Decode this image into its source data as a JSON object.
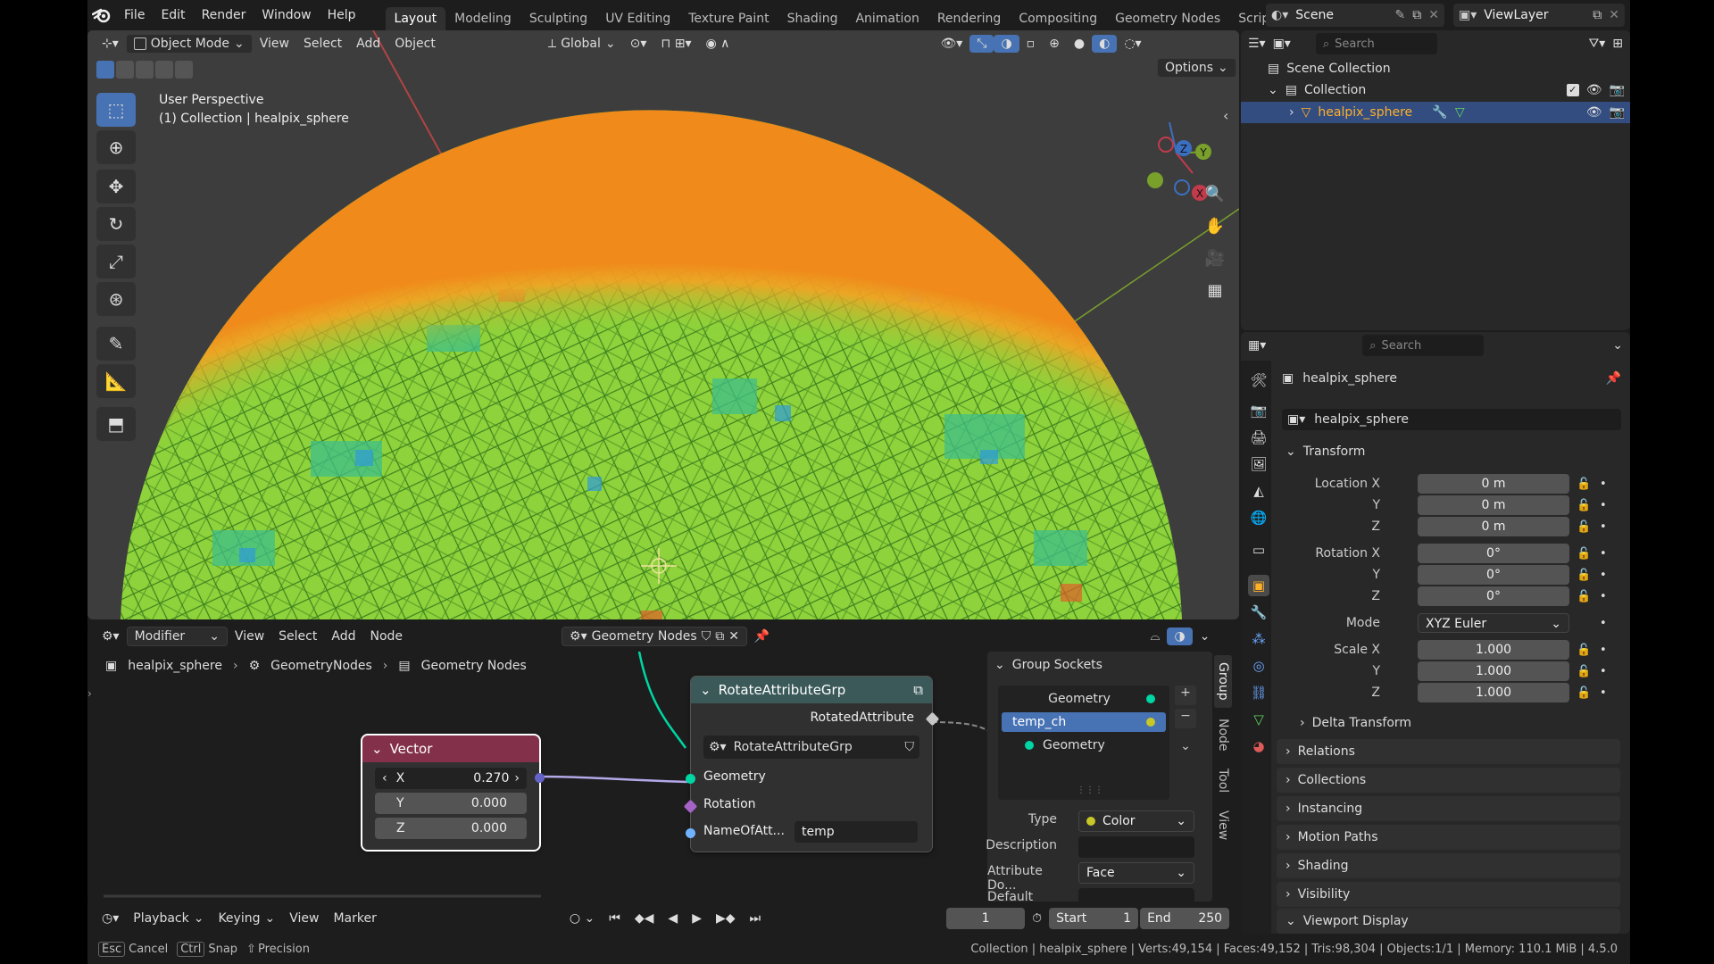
{
  "topbar": {
    "menus": [
      "File",
      "Edit",
      "Render",
      "Window",
      "Help"
    ],
    "workspaces": [
      "Layout",
      "Modeling",
      "Sculpting",
      "UV Editing",
      "Texture Paint",
      "Shading",
      "Animation",
      "Rendering",
      "Compositing",
      "Geometry Nodes",
      "Scripting"
    ],
    "active_workspace": "Layout",
    "add_tab": "+",
    "scene": "Scene",
    "view_layer": "ViewLayer"
  },
  "viewport": {
    "mode": "Object Mode",
    "menus": [
      "View",
      "Select",
      "Add",
      "Object"
    ],
    "orientation": "Global",
    "options": "Options",
    "overlay_title": "User Perspective",
    "overlay_subtitle": "(1) Collection | healpix_sphere",
    "gizmo": {
      "x": "X",
      "y": "Y",
      "z": "Z"
    }
  },
  "node_editor": {
    "editor_type": "Modifier",
    "menus": [
      "View",
      "Select",
      "Add",
      "Node"
    ],
    "tree_name": "Geometry Nodes",
    "breadcrumb": [
      "healpix_sphere",
      "GeometryNodes",
      "Geometry Nodes"
    ],
    "group_node": {
      "title": "RotateAttributeGrp",
      "output": "RotatedAttribute",
      "datablock": "RotateAttributeGrp",
      "inputs": [
        "Geometry",
        "Rotation",
        "NameOfAtt..."
      ],
      "name_value": "temp"
    },
    "vector_node": {
      "title": "Vector",
      "x_label": "X",
      "x": "0.270",
      "y_label": "Y",
      "y": "0.000",
      "z_label": "Z",
      "z": "0.000"
    },
    "group_sockets": {
      "title": "Group Sockets",
      "items": [
        "Geometry",
        "temp_ch",
        "Geometry"
      ],
      "type_label": "Type",
      "type_value": "Color",
      "description_label": "Description",
      "attr_domain_label": "Attribute Do...",
      "attr_domain_value": "Face",
      "default_attr_label": "Default Attri..."
    },
    "side_tabs": [
      "Group",
      "Node",
      "Tool",
      "View"
    ]
  },
  "timeline": {
    "menus": [
      "Playback",
      "Keying",
      "View",
      "Marker"
    ],
    "current_frame": "1",
    "start_label": "Start",
    "start": "1",
    "end_label": "End",
    "end": "250"
  },
  "statusbar": {
    "esc": "Esc",
    "cancel": "Cancel",
    "ctrl": "Ctrl",
    "snap": "Snap",
    "precision": "Precision",
    "info": "Collection | healpix_sphere | Verts:49,154 | Faces:49,152 | Tris:98,304 | Objects:1/1 | Memory: 110.1 MiB | 4.5.0"
  },
  "outliner": {
    "search_placeholder": "Search",
    "scene_collection": "Scene Collection",
    "collection": "Collection",
    "object": "healpix_sphere"
  },
  "properties": {
    "search_placeholder": "Search",
    "object_name": "healpix_sphere",
    "data_name": "healpix_sphere",
    "transform": "Transform",
    "location_x_label": "Location X",
    "location_x": "0 m",
    "location_y_label": "Y",
    "location_y": "0 m",
    "location_z_label": "Z",
    "location_z": "0 m",
    "rotation_x_label": "Rotation X",
    "rotation_x": "0°",
    "rotation_y_label": "Y",
    "rotation_y": "0°",
    "rotation_z_label": "Z",
    "rotation_z": "0°",
    "mode_label": "Mode",
    "mode": "XYZ Euler",
    "scale_x_label": "Scale X",
    "scale_x": "1.000",
    "scale_y_label": "Y",
    "scale_y": "1.000",
    "scale_z_label": "Z",
    "scale_z": "1.000",
    "delta_transform": "Delta Transform",
    "panels": [
      "Relations",
      "Collections",
      "Instancing",
      "Motion Paths",
      "Shading",
      "Visibility",
      "Viewport Display"
    ]
  },
  "colors": {
    "accent": "#4772b3",
    "selected_text": "#ffaf29",
    "vector_header": "#83314a",
    "group_header": "#3b5959",
    "geometry_socket": "#00d6a3",
    "vector_socket": "#6363c7",
    "rotation_socket": "#a663c7",
    "string_socket": "#70b2ff",
    "color_socket": "#c7c729"
  }
}
